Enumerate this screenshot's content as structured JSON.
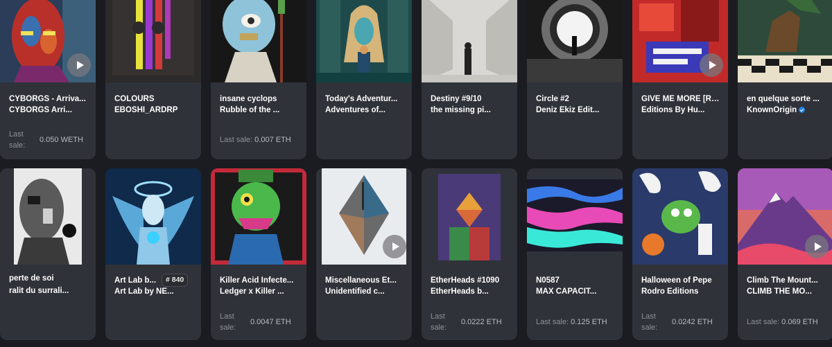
{
  "row1": [
    {
      "line1": "CYBORGS - Arriva...",
      "line2": "CYBORGS Arri...",
      "sale_label": "Last sale:",
      "sale_value": "0.050 WETH"
    },
    {
      "line1": "COLOURS",
      "line2": "EBOSHI_ARDRP",
      "sale_label": "",
      "sale_value": ""
    },
    {
      "line1": "insane cyclops",
      "line2": "Rubble of the ...",
      "sale_label": "Last sale:",
      "sale_value": "0.007 ETH"
    },
    {
      "line1": "Today's Adventur...",
      "line2": "Adventures of...",
      "sale_label": "",
      "sale_value": ""
    },
    {
      "line1": "Destiny #9/10",
      "line2": "the missing pi...",
      "sale_label": "",
      "sale_value": ""
    },
    {
      "line1": "Circle #2",
      "line2": "Deniz Ekiz Edit...",
      "sale_label": "",
      "sale_value": ""
    },
    {
      "line1": "GIVE ME MORE [RE...",
      "line2": "Editions By Hu...",
      "sale_label": "",
      "sale_value": ""
    },
    {
      "line1": "en quelque sorte ...",
      "line2": "KnownOrigin",
      "sale_label": "",
      "sale_value": ""
    }
  ],
  "row2": [
    {
      "line1": "perte de soi",
      "line2": "ralit du surrali...",
      "sale_label": "",
      "sale_value": ""
    },
    {
      "line1": "Art Lab b...",
      "line2": "Art Lab by NE...",
      "badge": "# 840",
      "sale_label": "",
      "sale_value": ""
    },
    {
      "line1": "Killer Acid Infecte...",
      "line2": "Ledger x Killer ...",
      "sale_label": "Last sale:",
      "sale_value": "0.0047 ETH"
    },
    {
      "line1": "Miscellaneous Et...",
      "line2": "Unidentified c...",
      "sale_label": "",
      "sale_value": ""
    },
    {
      "line1": "EtherHeads #1090",
      "line2": "EtherHeads b...",
      "sale_label": "Last sale:",
      "sale_value": "0.0222 ETH"
    },
    {
      "line1": "N0587",
      "line2": "MAX CAPACIT...",
      "sale_label": "Last sale:",
      "sale_value": "0.125 ETH"
    },
    {
      "line1": "Halloween of Pepe",
      "line2": "Rodro Editions",
      "sale_label": "Last sale:",
      "sale_value": "0.0242 ETH"
    },
    {
      "line1": "Climb The Mount...",
      "line2": "CLIMB THE MO...",
      "sale_label": "Last sale:",
      "sale_value": "0.069 ETH"
    }
  ],
  "icons": {
    "play": "play-icon",
    "verified": "verified-badge-icon"
  },
  "colors": {
    "card_bg": "#303239",
    "page_bg": "#1b1c21",
    "text": "#ffffff",
    "muted": "#8f9199"
  }
}
